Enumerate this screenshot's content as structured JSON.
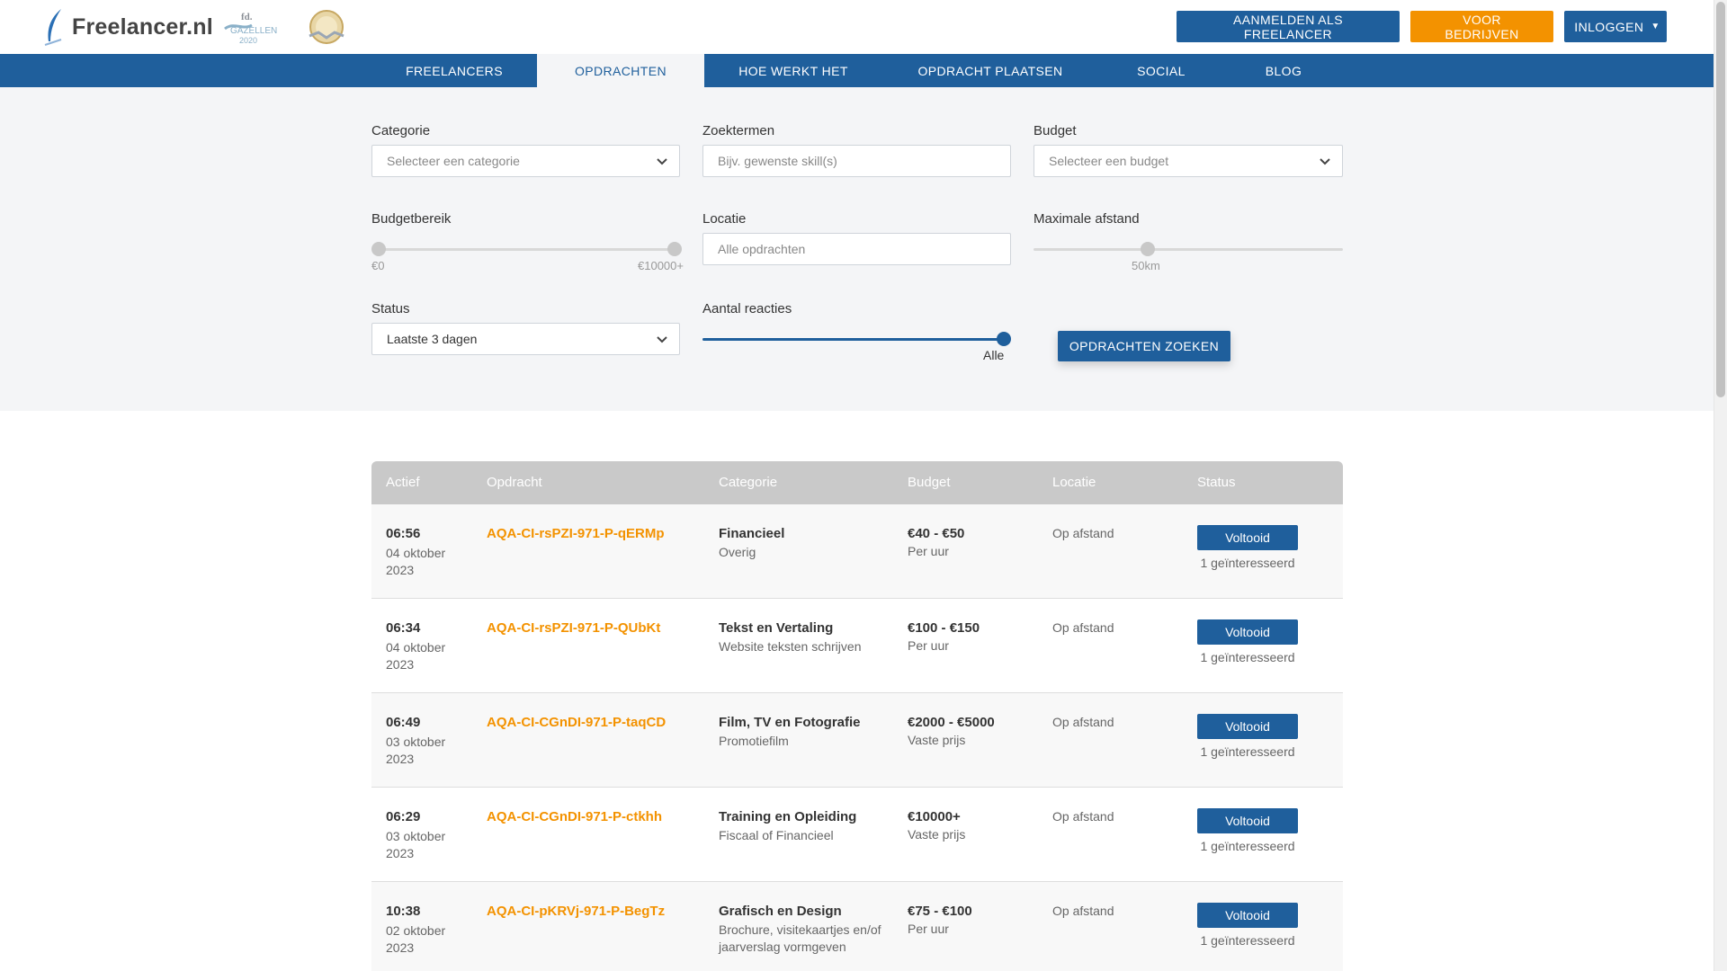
{
  "header": {
    "logo_text": "Freelancer.nl",
    "badge_gazellen_line1": "fd.",
    "badge_gazellen_line2": "GAZELLEN",
    "badge_gazellen_year": "2020",
    "actions": {
      "register_label": "AANMELDEN ALS FREELANCER",
      "business_label": "VOOR BEDRIJVEN",
      "login_label": "INLOGGEN"
    }
  },
  "nav": {
    "items": [
      {
        "label": "FREELANCERS",
        "active": false
      },
      {
        "label": "OPDRACHTEN",
        "active": true
      },
      {
        "label": "HOE WERKT HET",
        "active": false
      },
      {
        "label": "OPDRACHT PLAATSEN",
        "active": false
      },
      {
        "label": "SOCIAL",
        "active": false
      },
      {
        "label": "BLOG",
        "active": false
      }
    ]
  },
  "filters": {
    "category": {
      "label": "Categorie",
      "placeholder": "Selecteer een categorie"
    },
    "keywords": {
      "label": "Zoektermen",
      "placeholder": "Bijv. gewenste skill(s)"
    },
    "budget": {
      "label": "Budget",
      "placeholder": "Selecteer een budget"
    },
    "budget_range": {
      "label": "Budgetbereik",
      "min_label": "€0",
      "max_label": "€10000+",
      "min_fraction": 0.0,
      "max_fraction": 1.0
    },
    "location": {
      "label": "Locatie",
      "placeholder": "Alle opdrachten"
    },
    "max_distance": {
      "label": "Maximale afstand",
      "value_label": "50km",
      "fraction": 0.37
    },
    "status": {
      "label": "Status",
      "value": "Laatste 3 dagen"
    },
    "reactions": {
      "label": "Aantal reacties",
      "value_label": "Alle",
      "fraction": 1.0
    },
    "search_button": "OPDRACHTEN ZOEKEN"
  },
  "table": {
    "headers": {
      "actief": "Actief",
      "opdracht": "Opdracht",
      "categorie": "Categorie",
      "budget": "Budget",
      "locatie": "Locatie",
      "status": "Status"
    },
    "rows": [
      {
        "time": "06:56",
        "date": "04 oktober 2023",
        "opdracht": "AQA-CI-rsPZI-971-P-qERMp",
        "cat_main": "Financieel",
        "cat_sub": "Overig",
        "budget_main": "€40 - €50",
        "budget_sub": "Per uur",
        "location": "Op afstand",
        "status": "Voltooid",
        "interest": "1 geïnteresseerd"
      },
      {
        "time": "06:34",
        "date": "04 oktober 2023",
        "opdracht": "AQA-CI-rsPZI-971-P-QUbKt",
        "cat_main": "Tekst en Vertaling",
        "cat_sub": "Website teksten schrijven",
        "budget_main": "€100 - €150",
        "budget_sub": "Per uur",
        "location": "Op afstand",
        "status": "Voltooid",
        "interest": "1 geïnteresseerd"
      },
      {
        "time": "06:49",
        "date": "03 oktober 2023",
        "opdracht": "AQA-CI-CGnDI-971-P-taqCD",
        "cat_main": "Film, TV en Fotografie",
        "cat_sub": "Promotiefilm",
        "budget_main": "€2000 - €5000",
        "budget_sub": "Vaste prijs",
        "location": "Op afstand",
        "status": "Voltooid",
        "interest": "1 geïnteresseerd"
      },
      {
        "time": "06:29",
        "date": "03 oktober 2023",
        "opdracht": "AQA-CI-CGnDI-971-P-ctkhh",
        "cat_main": "Training en Opleiding",
        "cat_sub": "Fiscaal of Financieel",
        "budget_main": "€10000+",
        "budget_sub": "Vaste prijs",
        "location": "Op afstand",
        "status": "Voltooid",
        "interest": "1 geïnteresseerd"
      },
      {
        "time": "10:38",
        "date": "02 oktober 2023",
        "opdracht": "AQA-CI-pKRVj-971-P-BegTz",
        "cat_main": "Grafisch en Design",
        "cat_sub": "Brochure, visitekaartjes en/of jaarverslag vormgeven",
        "budget_main": "€75 - €100",
        "budget_sub": "Per uur",
        "location": "Op afstand",
        "status": "Voltooid",
        "interest": "1 geïnteresseerd"
      }
    ]
  },
  "colors": {
    "primary": "#1f5f9c",
    "accent": "#f39200",
    "filter_bg": "#f4f5f7",
    "table_header": "#c9c9c9"
  }
}
